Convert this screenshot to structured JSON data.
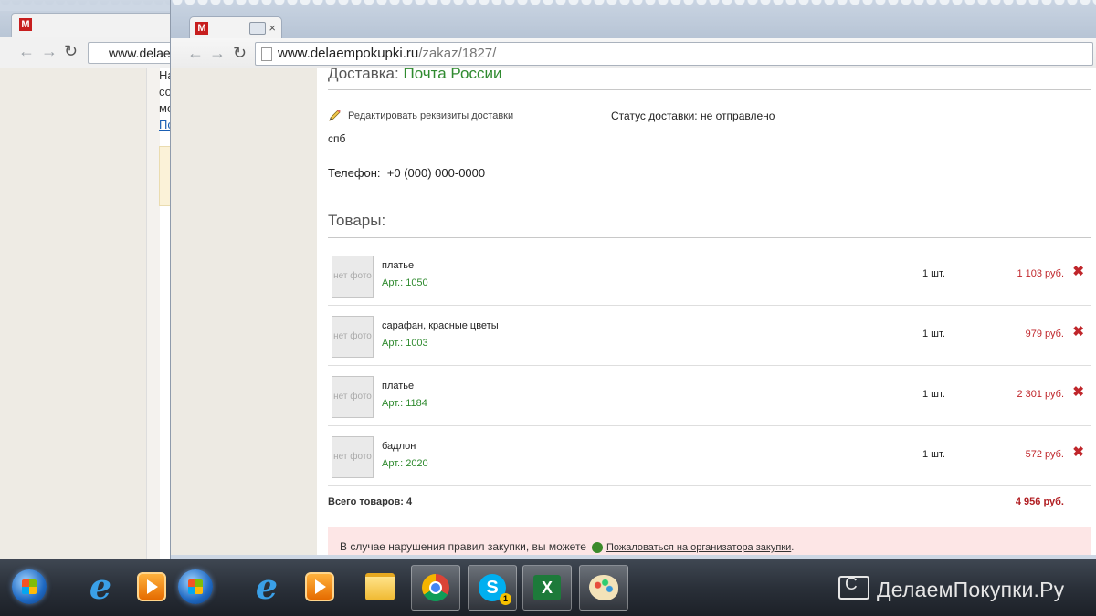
{
  "background_window": {
    "favicon": "M",
    "url": "www.delaemp",
    "partial_lines": [
      "На",
      "со",
      "мо",
      "По"
    ]
  },
  "browser": {
    "tab_favicon": "M",
    "tab_close": "×",
    "url_domain": "www.delaempokupki.ru",
    "url_path": "/zakaz/1827/",
    "icons": [
      "back-icon",
      "forward-icon",
      "reload-icon",
      "page-icon"
    ]
  },
  "order": {
    "delivery_label": "Доставка:",
    "delivery_carrier": "Почта России",
    "edit_link": "Редактировать реквизиты доставки",
    "status_label": "Статус доставки:",
    "status_value": "не отправлено",
    "city": "спб",
    "phone_label": "Телефон:",
    "phone_value": "+0 (000) 000-0000",
    "goods_heading": "Товары:",
    "no_photo": "нет фото",
    "items": [
      {
        "name": "платье",
        "art": "Арт.: 1050",
        "qty": "1 шт.",
        "price": "1 103 руб."
      },
      {
        "name": "сарафан, красные цветы",
        "art": "Арт.: 1003",
        "qty": "1 шт.",
        "price": "979 руб."
      },
      {
        "name": "платье",
        "art": "Арт.: 1184",
        "qty": "1 шт.",
        "price": "2 301 руб."
      },
      {
        "name": "бадлон",
        "art": "Арт.: 2020",
        "qty": "1 шт.",
        "price": "572 руб."
      }
    ],
    "delete_glyph": "✖",
    "total_label": "Всего товаров: 4",
    "total_sum": "4 956 руб.",
    "notice_text": "В случае нарушения правил закупки, вы можете",
    "complaint_link": "Пожаловаться на организатора закупки",
    "complaint_period": "."
  },
  "taskbar": {
    "apps": [
      "windows-start",
      "internet-explorer",
      "media-player",
      "windows-start",
      "internet-explorer",
      "media-player",
      "explorer-folder",
      "chrome",
      "skype",
      "excel",
      "paint"
    ],
    "skype_badge": "1",
    "ie_glyph": "e",
    "skype_glyph": "S",
    "excel_glyph": "X",
    "brand": "ДелаемПокупки.Ру"
  }
}
